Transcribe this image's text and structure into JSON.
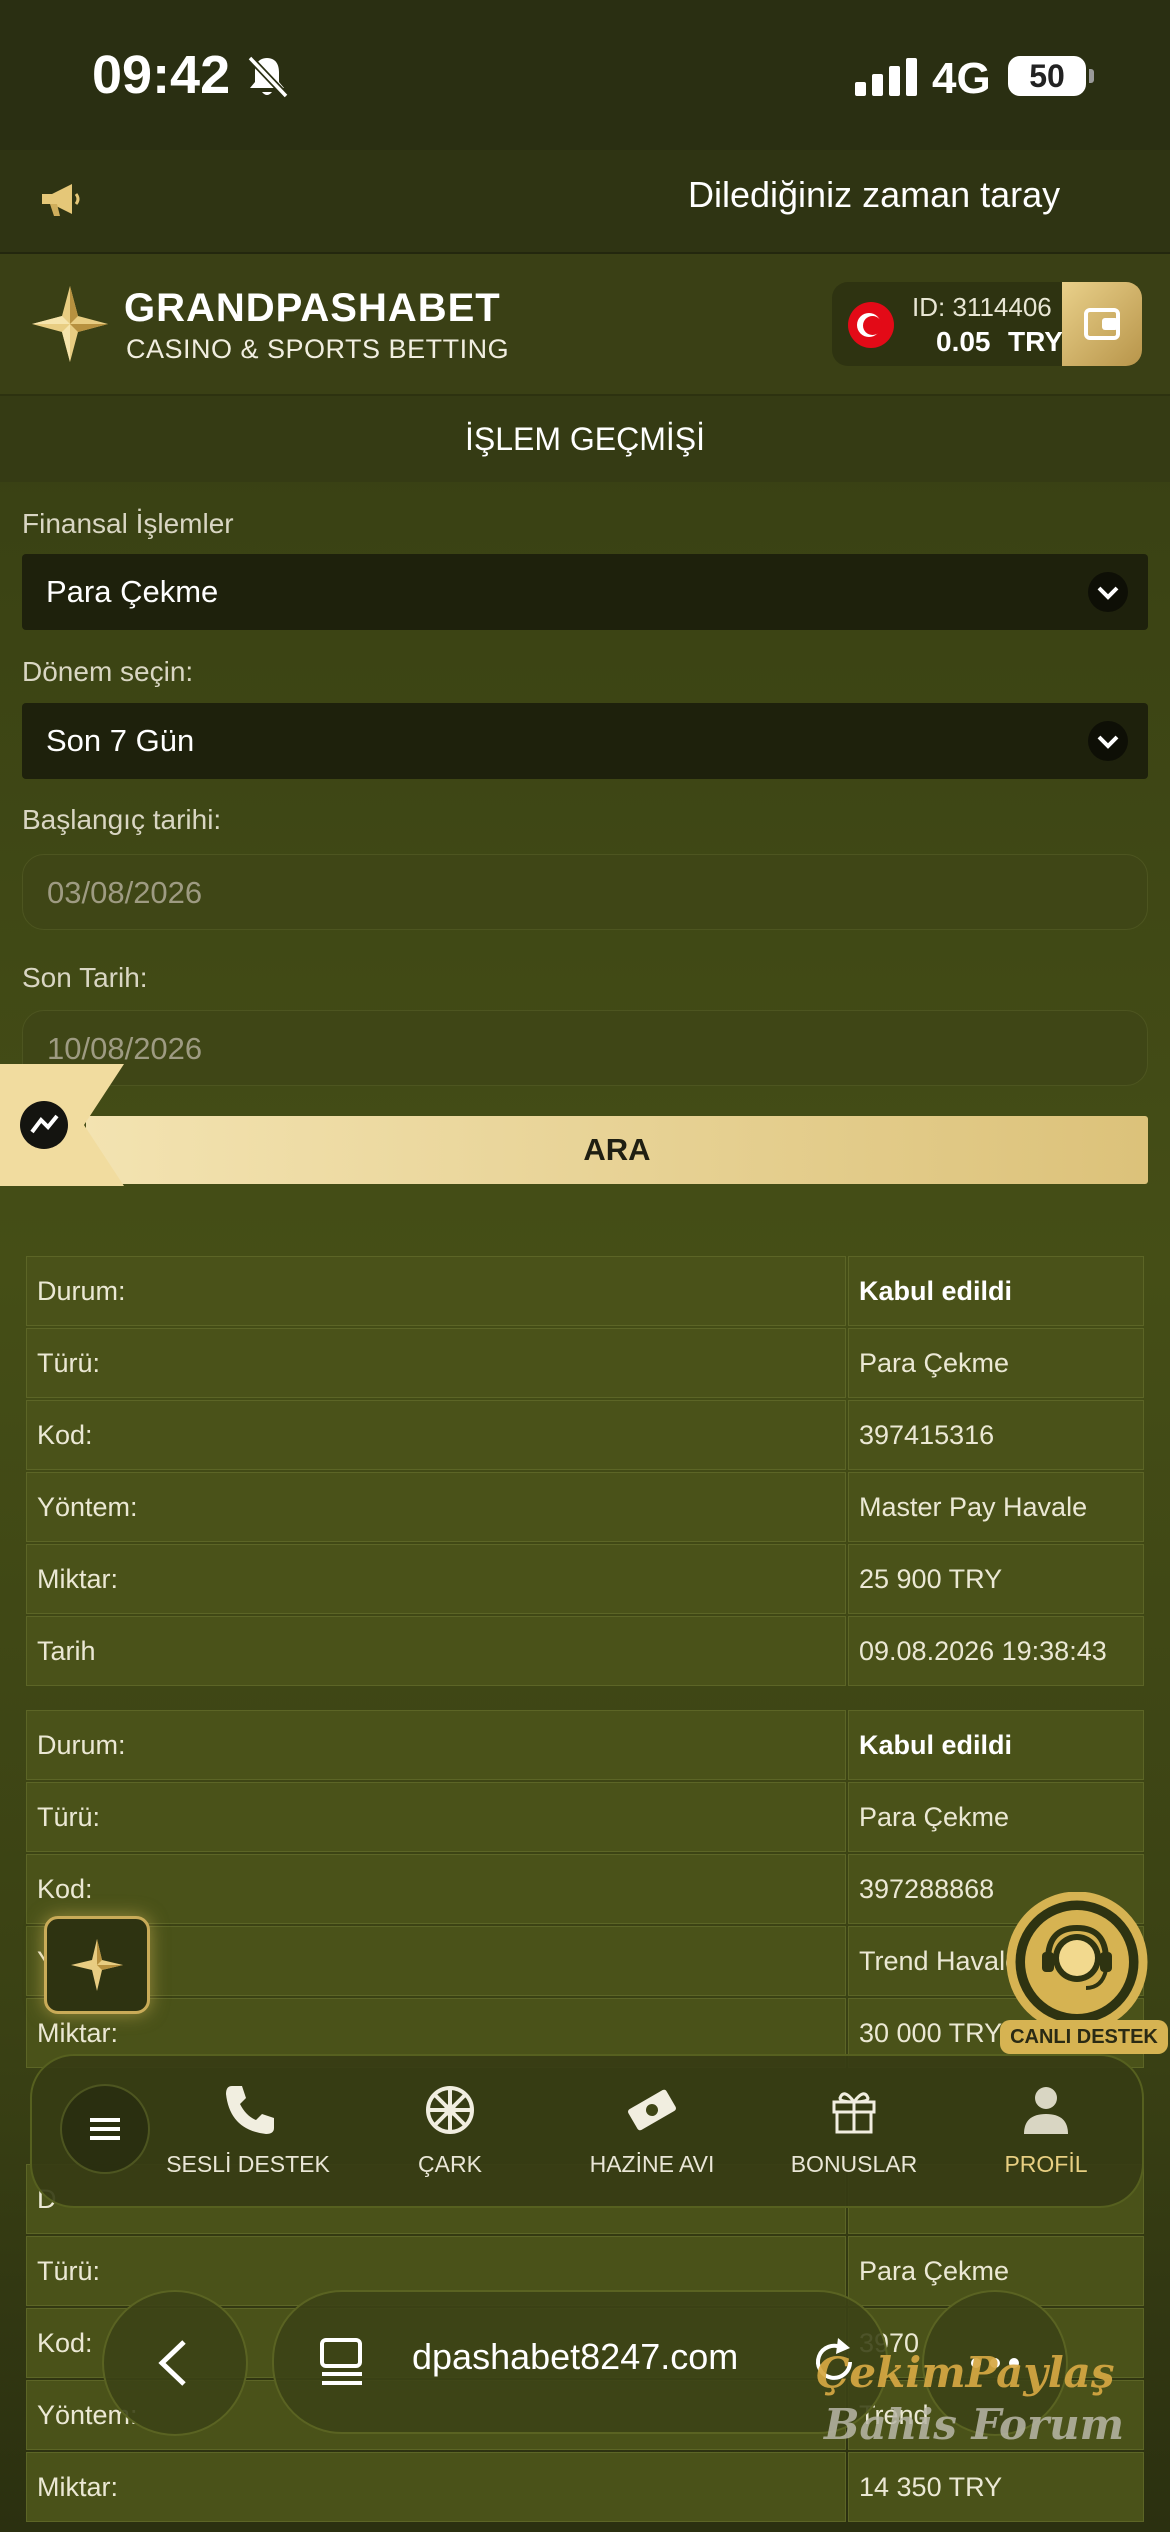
{
  "status_bar": {
    "time": "09:42",
    "network": "4G",
    "battery": "50"
  },
  "marquee": {
    "text": "Dilediğiniz zaman taray"
  },
  "header": {
    "brand": "GRANDPASHABET",
    "brand_sub": "CASINO & SPORTS BETTING",
    "account_id": "ID: 3114406",
    "balance": "0.05",
    "currency": "TRY"
  },
  "page_title": "İŞLEM GEÇMİŞİ",
  "filters": {
    "financial_label": "Finansal İşlemler",
    "financial_value": "Para Çekme",
    "period_label": "Dönem seçin:",
    "period_value": "Son 7 Gün",
    "start_label": "Başlangıç tarihi:",
    "start_value": "03/08/2026",
    "end_label": "Son Tarih:",
    "end_value": "10/08/2026",
    "search_button": "ARA"
  },
  "transactions": [
    {
      "rows": [
        {
          "label": "Durum:",
          "value": "Kabul edildi"
        },
        {
          "label": "Türü:",
          "value": "Para Çekme"
        },
        {
          "label": "Kod:",
          "value": "397415316"
        },
        {
          "label": "Yöntem:",
          "value": "Master Pay Havale"
        },
        {
          "label": "Miktar:",
          "value": "25 900 TRY"
        },
        {
          "label": "Tarih",
          "value": "09.08.2026 19:38:43"
        }
      ]
    },
    {
      "rows": [
        {
          "label": "Durum:",
          "value": "Kabul edildi"
        },
        {
          "label": "Türü:",
          "value": "Para Çekme"
        },
        {
          "label": "Kod:",
          "value": "397288868"
        },
        {
          "label": "Y",
          "value": "Trend Havale"
        },
        {
          "label": "Miktar:",
          "value": "30 000 TRY"
        }
      ]
    },
    {
      "rows": [
        {
          "label": "D",
          "value": ""
        },
        {
          "label": "Türü:",
          "value": "Para Çekme"
        },
        {
          "label": "Kod:",
          "value": "3970"
        },
        {
          "label": "Yöntem:",
          "value": "Trend"
        },
        {
          "label": "Miktar:",
          "value": "14 350 TRY"
        }
      ]
    }
  ],
  "live_support": {
    "label": "CANLI DESTEK"
  },
  "bottom_nav": [
    {
      "label": "SESLİ DESTEK",
      "icon": "phone-icon"
    },
    {
      "label": "ÇARK",
      "icon": "wheel-icon"
    },
    {
      "label": "HAZİNE AVI",
      "icon": "ticket-icon"
    },
    {
      "label": "BONUSLAR",
      "icon": "gift-icon"
    },
    {
      "label": "PROFİL",
      "icon": "user-icon"
    }
  ],
  "browser": {
    "url": "dpashabet8247.com"
  },
  "watermark": {
    "line1": "ÇekimPaylaş",
    "line2": "Bahis Forum"
  },
  "colors": {
    "accent_gold": "#d6b352",
    "background": "#3a4214"
  }
}
